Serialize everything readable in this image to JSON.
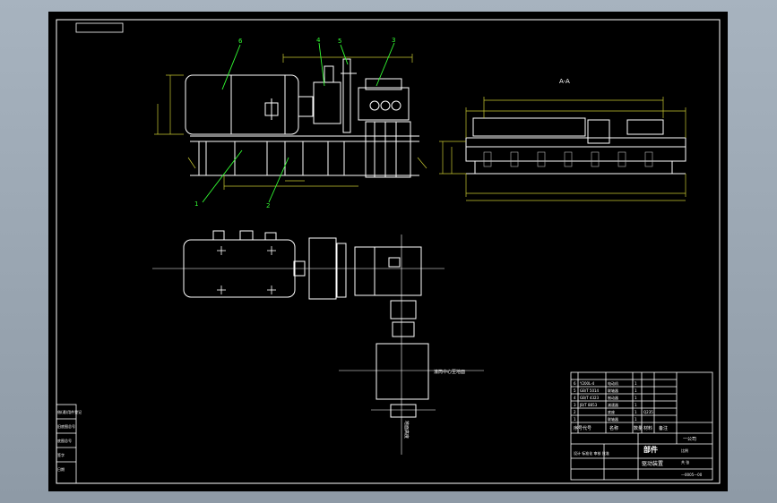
{
  "drawing": {
    "section_label": "A-A",
    "balloons": [
      "6",
      "4",
      "5",
      "3",
      "2",
      "1"
    ],
    "shaft_note": "滚筒中心至地面",
    "side_note": "地面高度"
  },
  "title_block": {
    "title": "驱动装置",
    "material": "部件",
    "drawing_no": "—0005—00",
    "company": "一公司",
    "scale_label": "比例",
    "sheet_label": "共 张",
    "designer_row": "设计 标准化 审核 批准",
    "parts_header": [
      "序号",
      "代号",
      "名称",
      "数量",
      "材料",
      "备注"
    ],
    "parts_rows": [
      [
        "6",
        "Y200L-4",
        "电动机",
        "1",
        "",
        ""
      ],
      [
        "5",
        "GB/T 5014",
        "联轴器",
        "1",
        "",
        ""
      ],
      [
        "4",
        "GB/T 4323",
        "制动器",
        "1",
        "",
        ""
      ],
      [
        "3",
        "JB/T 8853",
        "减速器",
        "1",
        "",
        ""
      ],
      [
        "2",
        "",
        "底座",
        "1",
        "Q235",
        ""
      ],
      [
        "1",
        "",
        "联轴器",
        "1",
        "",
        ""
      ]
    ]
  },
  "side_table": [
    "借(通)用件登记",
    "旧底图总号",
    "底图总号",
    "签字",
    "日期"
  ]
}
